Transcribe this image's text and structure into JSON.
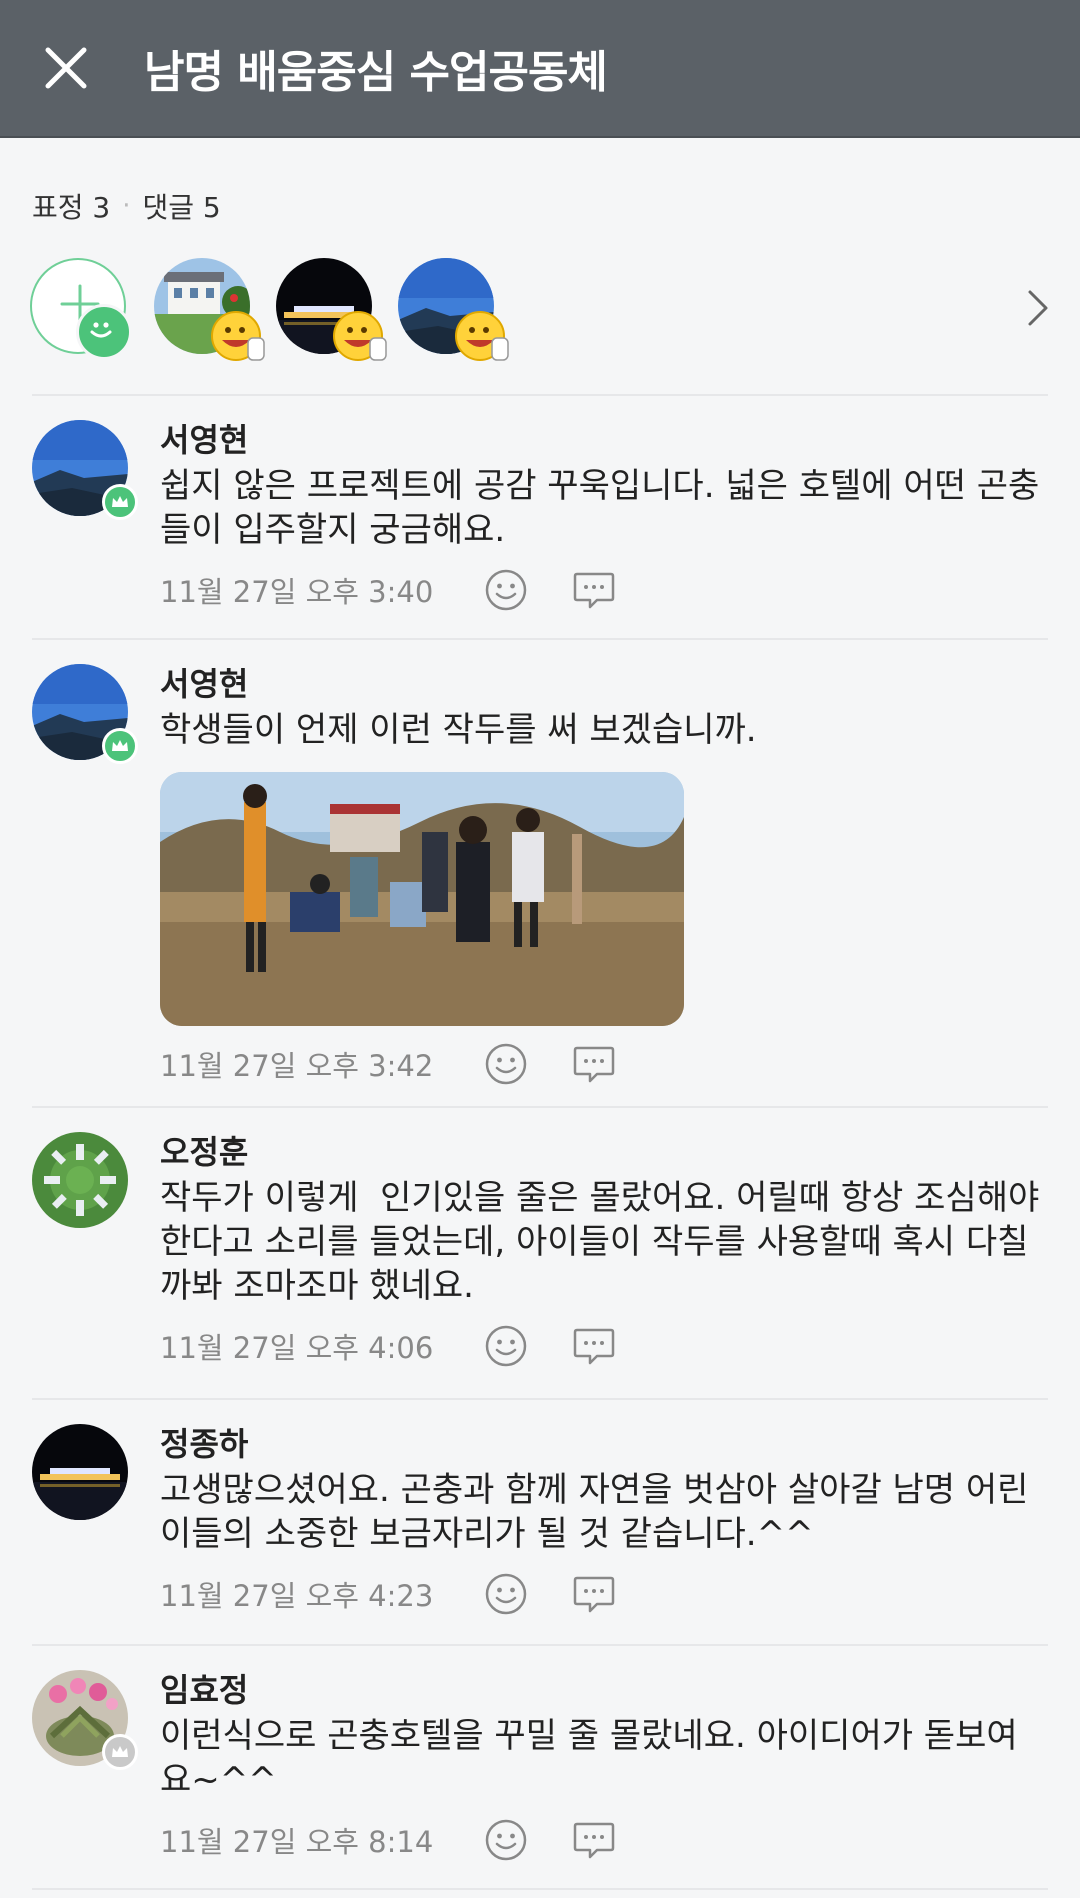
{
  "header": {
    "title": "남명 배움중심 수업공동체",
    "close_icon": "close-icon"
  },
  "summary": {
    "reactions_label": "표정 3",
    "separator": "·",
    "comments_label": "댓글 5"
  },
  "colors": {
    "header_bg": "#5b6167",
    "accent_green": "#4cc37a",
    "text_gray": "#888888"
  },
  "comments": [
    {
      "name": "서영현",
      "text": "쉽지 않은 프로젝트에 공감 꾸욱입니다. 넓은 호텔에 어떤 곤충들이 입주할지 궁금해요.",
      "time": "11월 27일 오후 3:40"
    },
    {
      "name": "서영현",
      "text": "학생들이 언제 이런 작두를 써 보겠습니까.",
      "time": "11월 27일 오후 3:42"
    },
    {
      "name": "오정훈",
      "text": "작두가 이렇게  인기있을 줄은 몰랐어요. 어릴때 항상 조심해야한다고 소리를 들었는데, 아이들이 작두를 사용할때 혹시 다칠까봐 조마조마 했네요.",
      "time": "11월 27일 오후 4:06"
    },
    {
      "name": "정종하",
      "text": "고생많으셨어요. 곤충과 함께 자연을 벗삼아 살아갈 남명 어린이들의 소중한 보금자리가 될 것 같습니다.^^",
      "time": "11월 27일 오후 4:23"
    },
    {
      "name": "임효정",
      "text": "이런식으로 곤충호텔을 꾸밀 줄 몰랐네요. 아이디어가 돋보여요~^^",
      "time": "11월 27일 오후 8:14"
    }
  ]
}
